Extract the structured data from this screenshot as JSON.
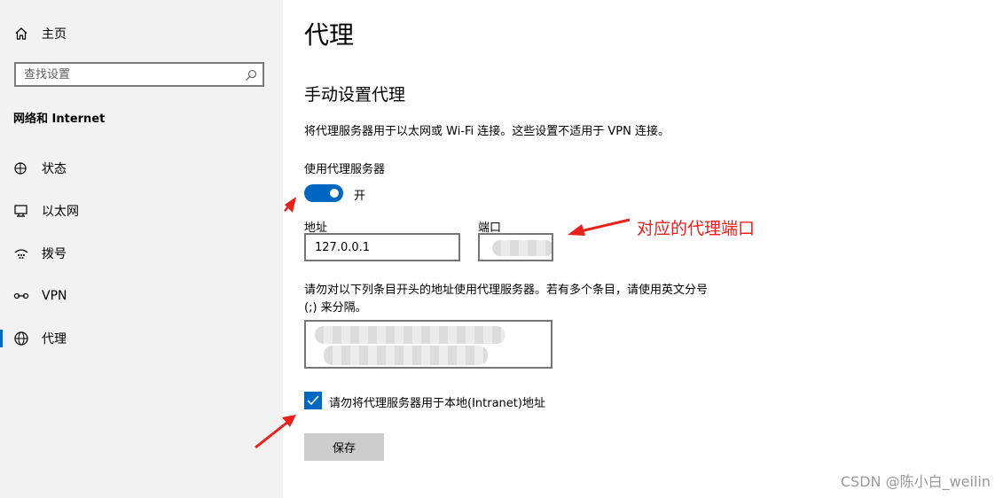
{
  "sidebar": {
    "home_label": "主页",
    "search_placeholder": "查找设置",
    "section_title": "网络和 Internet",
    "items": [
      {
        "label": "状态",
        "icon": "status-icon"
      },
      {
        "label": "以太网",
        "icon": "ethernet-icon"
      },
      {
        "label": "拨号",
        "icon": "dialup-icon"
      },
      {
        "label": "VPN",
        "icon": "vpn-icon"
      },
      {
        "label": "代理",
        "icon": "globe-icon",
        "active": true
      }
    ]
  },
  "main": {
    "title": "代理",
    "section_title": "手动设置代理",
    "description": "将代理服务器用于以太网或 Wi-Fi 连接。这些设置不适用于 VPN 连接。",
    "use_proxy_label": "使用代理服务器",
    "toggle_state": "开",
    "address_label": "地址",
    "address_value": "127.0.0.1",
    "port_label": "端口",
    "exceptions_description": "请勿对以下列条目开头的地址使用代理服务器。若有多个条目，请使用英文分号 (;) 来分隔。",
    "bypass_local_label": "请勿将代理服务器用于本地(Intranet)地址",
    "save_label": "保存"
  },
  "annotations": {
    "port_note": "对应的代理端口"
  },
  "watermark": "CSDN @陈小白_weilin",
  "colors": {
    "accent": "#0067c0",
    "annotation_red": "#e8211c",
    "sidebar_bg": "#f2f2f2"
  }
}
